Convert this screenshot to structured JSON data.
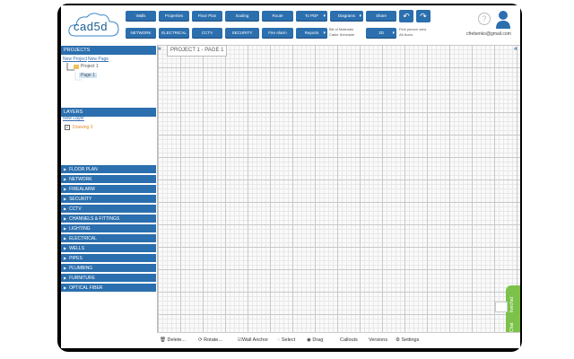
{
  "app": {
    "logo_text": "cad5d"
  },
  "toolbar": {
    "row1": [
      "Walls",
      "Properties",
      "Floor Plan",
      "Scaling",
      "Route",
      "To PDF",
      "Diagrams",
      "Share"
    ],
    "row2": [
      "NETWORK",
      "ELECTRICAL",
      "CCTV",
      "SECURITY",
      "Fire Alarm",
      "Reports",
      "3D"
    ],
    "bill_of_materials": "Bill of Materials",
    "cable_schedule": "Cable Schedule",
    "first_person_view": "First person view",
    "all_floors": "All floors",
    "undo_icon": "undo-icon",
    "redo_icon": "redo-icon"
  },
  "user": {
    "email": "cfrebenko@gmail.com",
    "help": "?"
  },
  "projects": {
    "header": "PROJECTS",
    "new_project": "New Project",
    "new_page": "New Page",
    "project_name": "Project 1",
    "page_name": "Page 1"
  },
  "layers": {
    "header": "LAYERS",
    "new_layer": "New Layer",
    "drawing_name": "Drawing 0"
  },
  "categories": [
    "FLOOR PLAN",
    "NETWORK",
    "FIREALARM",
    "SECURITY",
    "CCTV",
    "CHANNELS & FITTINGS",
    "LIGHTING",
    "ELECTRICAL",
    "WELLS",
    "PIPES",
    "PLUMBING",
    "FURNITURE",
    "OPTICAL FIBER"
  ],
  "canvas": {
    "page_title": "PROJECT 1 - PAGE 1",
    "collapse_left": "«",
    "collapse_right": "«"
  },
  "bottombar": {
    "delete": "Delete...",
    "rotate": "Rotate...",
    "wall_anchor": "Wall Anchor",
    "select": "Select",
    "drag": "Drag",
    "callouts": "Callouts",
    "versions": "Versions",
    "settings": "Settings"
  },
  "chat": {
    "livechat": "livechat",
    "chat": "Chat"
  },
  "colors": {
    "accent": "#2b6fae",
    "chat_green": "#7cc24a",
    "grid": "#c8c8c8"
  }
}
